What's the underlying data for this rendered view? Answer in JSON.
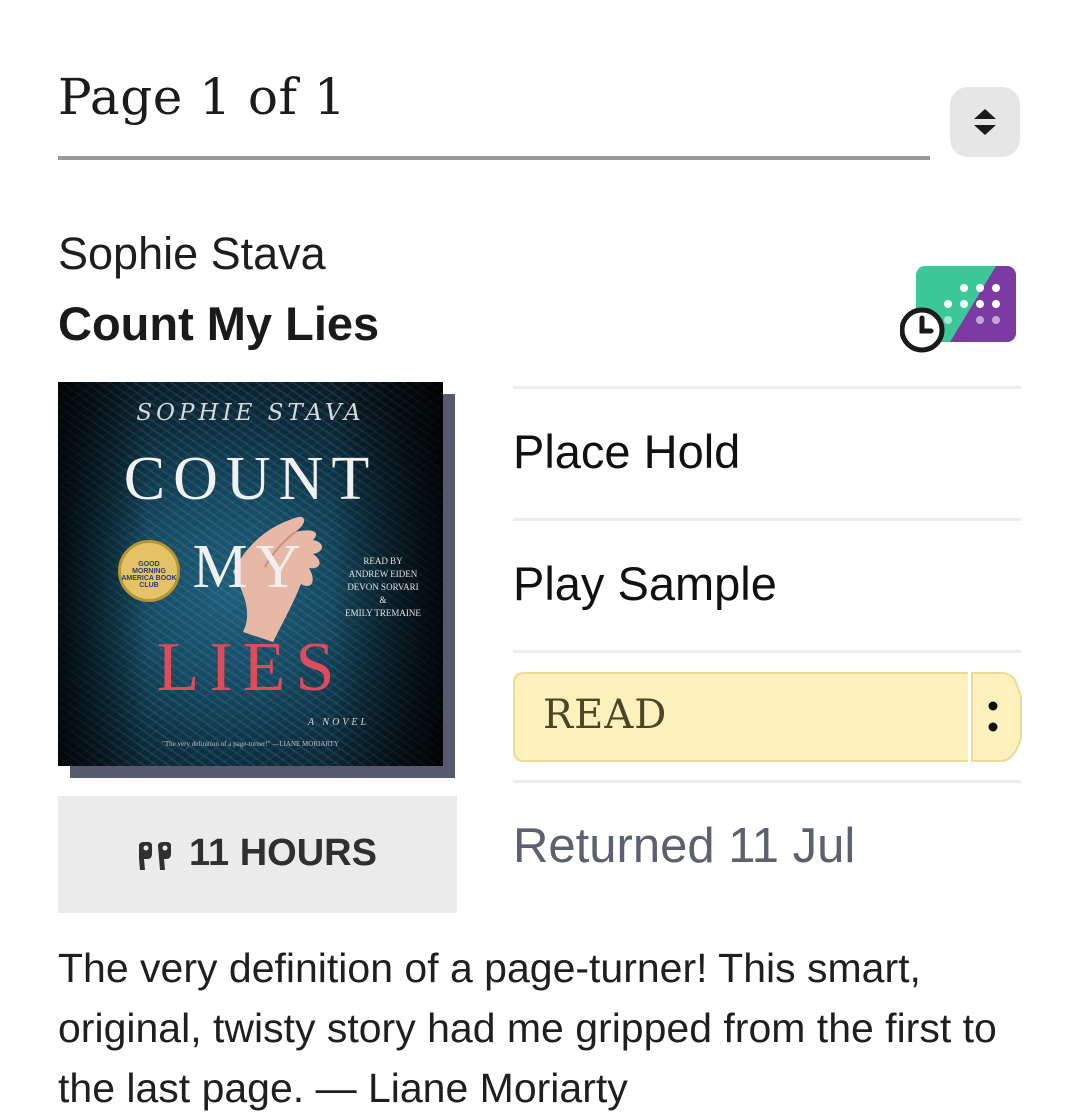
{
  "pager": {
    "label": "Page 1 of 1"
  },
  "book": {
    "author": "Sophie Stava",
    "title": "Count My Lies",
    "duration": "11 HOURS",
    "status": "Returned 11 Jul",
    "description": "The very definition of a page-turner! This smart, original, twisty story had me gripped from the first to the last page. — Liane Moriarty"
  },
  "cover": {
    "author": "SOPHIE STAVA",
    "title_word1": "COUNT",
    "title_word2": "MY",
    "title_word3": "LIES",
    "seal_text": "GOOD MORNING AMERICA BOOK CLUB",
    "read_by": "READ BY",
    "reader1": "ANDREW EIDEN",
    "reader2": "DEVON SORVARI",
    "amp": "&",
    "reader3": "EMILY TREMAINE",
    "genre": "A NOVEL",
    "quote": "\"The very definition of a page-turner!\" —LIANE MORIARTY"
  },
  "actions": {
    "place_hold": "Place Hold",
    "play_sample": "Play Sample",
    "read": "READ"
  },
  "icons": {
    "stepper": "up-down-chevron-icon",
    "format_badge": "audiobook-format-badge-icon",
    "clock": "clock-icon",
    "headphones": "headphones-icon",
    "more": "vertical-dots-icon"
  },
  "colors": {
    "read_button_bg": "#fcf1bd",
    "badge_green": "#3cc99a",
    "badge_purple": "#7b3aa3",
    "returned_text": "#5c6170"
  }
}
